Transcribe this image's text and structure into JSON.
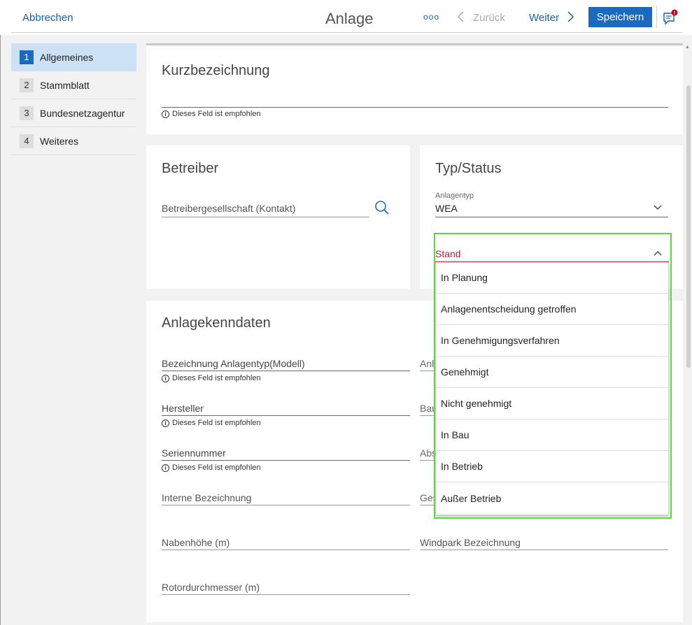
{
  "header": {
    "cancel": "Abbrechen",
    "title": "Anlage",
    "more": "ooo",
    "back": "Zurück",
    "next": "Weiter",
    "save": "Speichern",
    "chat_icon": "chat-alert-icon"
  },
  "sidebar": {
    "items": [
      {
        "num": "1",
        "label": "Allgemeines"
      },
      {
        "num": "2",
        "label": "Stammblatt"
      },
      {
        "num": "3",
        "label": "Bundesnetzagentur"
      },
      {
        "num": "4",
        "label": "Weiteres"
      }
    ]
  },
  "kurz": {
    "title": "Kurzbezeichnung",
    "hint": "Dieses Feld ist empfohlen"
  },
  "betreiber": {
    "title": "Betreiber",
    "placeholder": "Betreibergesellschaft (Kontakt)"
  },
  "typ": {
    "title": "Typ/Status",
    "anlagentyp_label": "Anlagentyp",
    "anlagentyp_value": "WEA",
    "stand_label": "Stand",
    "options": [
      "In Planung",
      "Anlagenentscheidung getroffen",
      "In Genehmigungsverfahren",
      "Genehmigt",
      "Nicht genehmigt",
      "In Bau",
      "In Betrieb",
      "Außer Betrieb"
    ]
  },
  "kenndaten": {
    "title": "Anlagekenndaten",
    "hint": "Dieses Feld ist empfohlen",
    "left_fields": [
      "Bezeichnung Anlagentyp(Modell)",
      "Hersteller",
      "Seriennummer",
      "Interne Bezeichnung",
      "Nabenhöhe (m)",
      "Rotordurchmesser (m)"
    ],
    "right_fields": [
      "Anl",
      "Bau",
      "Abs",
      "Ges",
      "Windpark Bezeichnung"
    ]
  }
}
